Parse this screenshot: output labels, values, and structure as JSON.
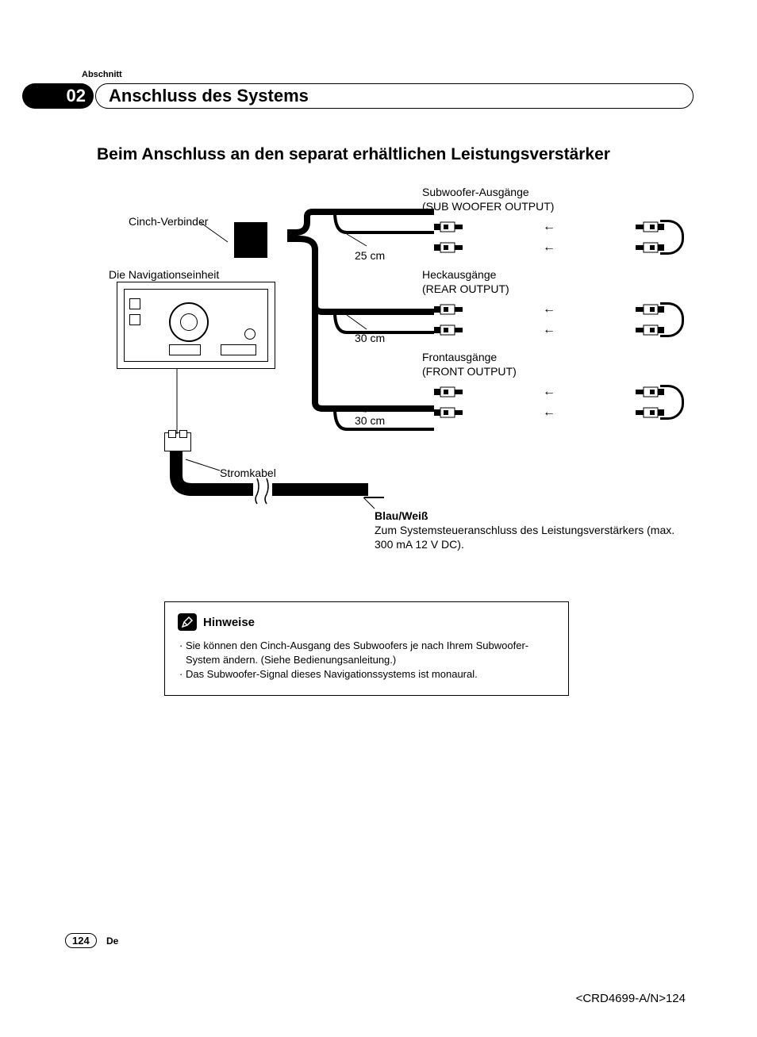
{
  "header": {
    "abschnitt_label": "Abschnitt",
    "section_number": "02",
    "section_title": "Anschluss des Systems"
  },
  "heading": "Beim Anschluss an den separat erhältlichen Leistungsverstärker",
  "labels": {
    "cinch": "Cinch-Verbinder",
    "nav_unit": "Die Navigationseinheit",
    "sub_out_1": "Subwoofer-Ausgänge",
    "sub_out_2": "(SUB WOOFER OUTPUT)",
    "len_25": "25 cm",
    "rear_out_1": "Heckausgänge",
    "rear_out_2": "(REAR OUTPUT)",
    "len_30_a": "30 cm",
    "front_out_1": "Frontausgänge",
    "front_out_2": "(FRONT OUTPUT)",
    "len_30_b": "30 cm",
    "stromkabel": "Stromkabel",
    "blau_weiss": "Blau/Weiß",
    "blau_weiss_desc": "Zum Systemsteueranschluss des Leistungsverstärkers (max. 300 mA 12 V DC)."
  },
  "notes": {
    "title": "Hinweise",
    "items": [
      "Sie können den Cinch-Ausgang des Subwoofers je nach Ihrem Subwoofer-System ändern. (Siehe Bedienungsanleitung.)",
      "Das Subwoofer-Signal dieses Navigationssystems ist monaural."
    ]
  },
  "footer": {
    "page_number": "124",
    "lang": "De",
    "doc_code": "<CRD4699-A/N>124"
  }
}
